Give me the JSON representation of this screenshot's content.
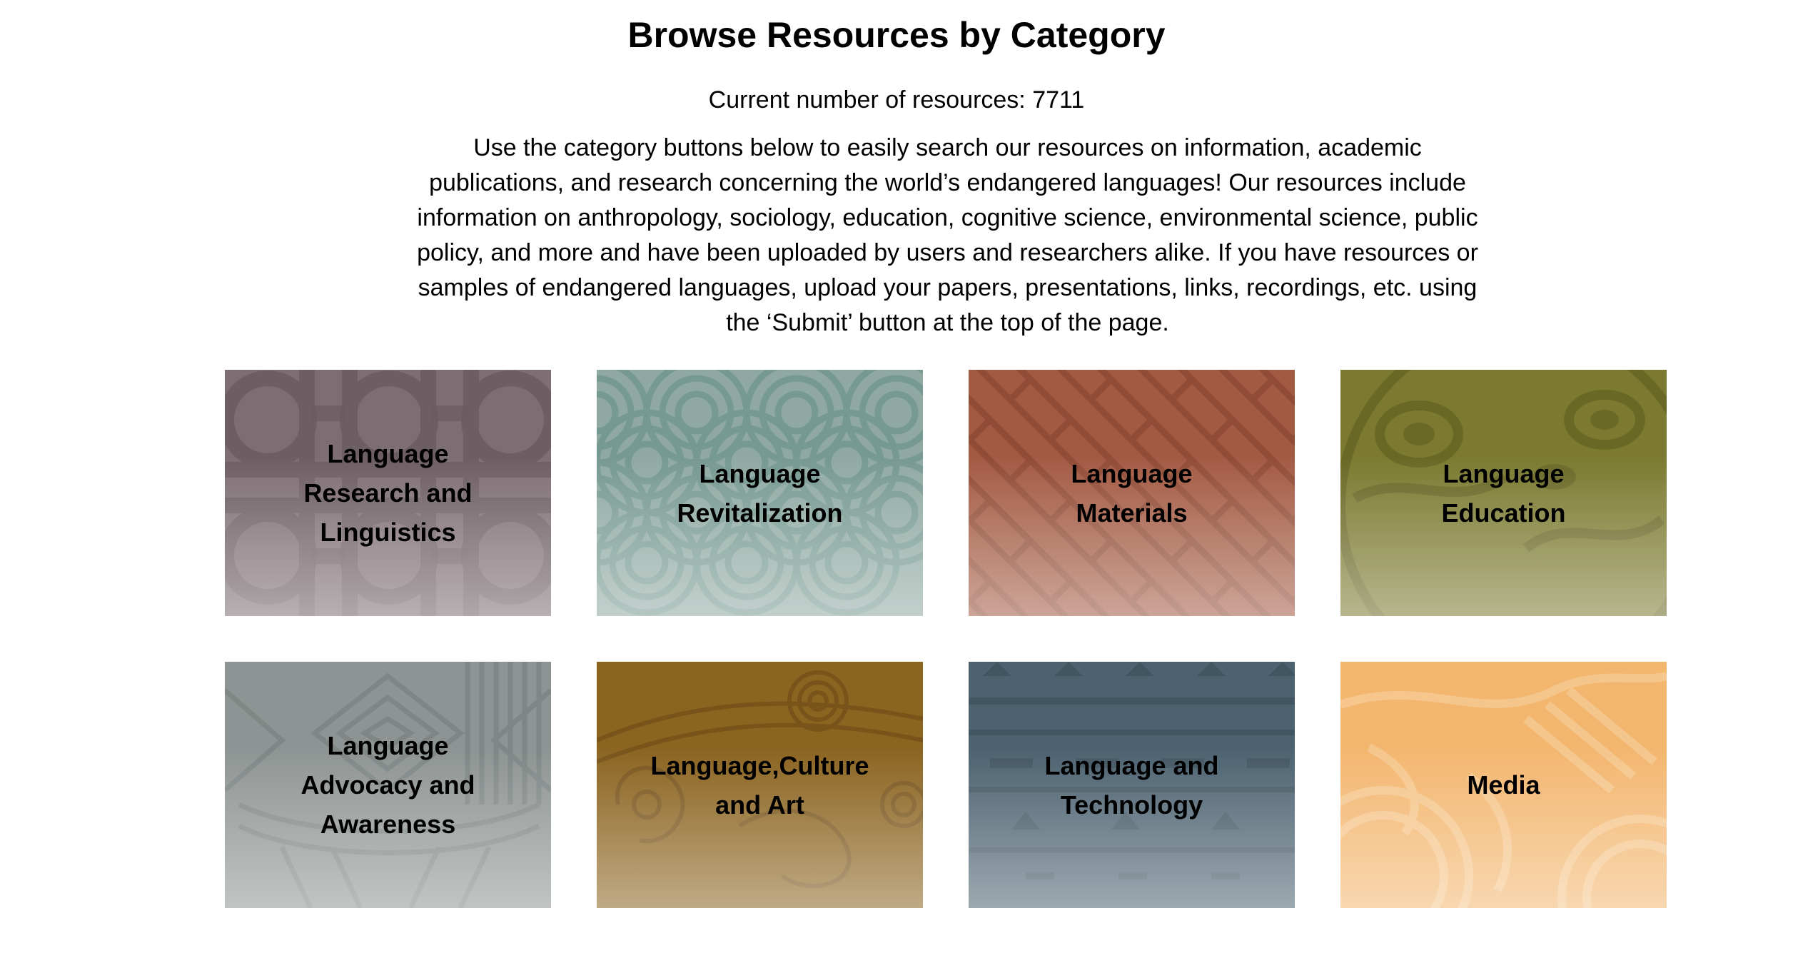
{
  "header": {
    "title": "Browse Resources by Category",
    "resource_count": "Current number of resources: 7711",
    "description": "Use the category buttons below to easily search our resources on information, academic publications, and research concerning the world’s endangered languages! Our resources include information on anthropology, sociology, education, cognitive science, environmental science, public policy, and more and have been uploaded by users and researchers alike. If you have resources or samples of endangered languages, upload your papers, presentations, links, recordings, etc. using the ‘Submit’ button at the top of the page."
  },
  "categories": [
    {
      "label": "Language Research and Linguistics",
      "color": "#7d6e74",
      "pattern": "celtic-knot"
    },
    {
      "label": "Language Revitalization",
      "color": "#8fa9a2",
      "pattern": "seigaiha-waves"
    },
    {
      "label": "Language Materials",
      "color": "#a35a43",
      "pattern": "greek-key-diagonal"
    },
    {
      "label": "Language Education",
      "color": "#7b7a30",
      "pattern": "formline-art"
    },
    {
      "label": "Language Advocacy and Awareness",
      "color": "#8e9493",
      "pattern": "geometric-lines"
    },
    {
      "label": "Language,Culture and Art",
      "color": "#8b6420",
      "pattern": "paisley"
    },
    {
      "label": "Language and Technology",
      "color": "#4c6270",
      "pattern": "woven-triangles"
    },
    {
      "label": "Media",
      "color": "#f3b66f",
      "pattern": "tribal-swirls"
    }
  ]
}
